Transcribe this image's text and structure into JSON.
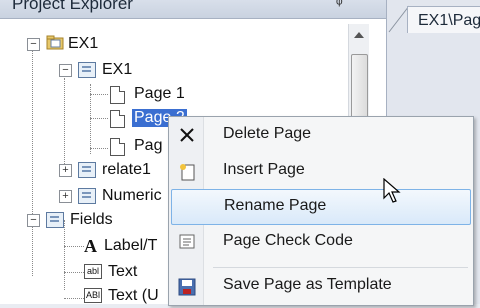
{
  "explorer": {
    "title": "Project Explorer",
    "pin_glyph": "ᵠ"
  },
  "tab": {
    "label": "EX1\\Pag"
  },
  "tree": {
    "root": "EX1",
    "view": "EX1",
    "page1": "Page 1",
    "page2": "Page 2",
    "page3": "Pag",
    "relate": "relate1",
    "numeric": "Numeric",
    "fields": "Fields",
    "label_field": "Label/T",
    "text_field": "Text",
    "text_upper": "Text (U"
  },
  "menu": {
    "items": [
      {
        "label": "Delete Page",
        "icon": "delete-x-icon"
      },
      {
        "label": "Insert Page",
        "icon": "insert-page-icon"
      },
      {
        "label": "Rename Page",
        "icon": "none"
      },
      {
        "label": "Page Check Code",
        "icon": "check-code-icon"
      },
      {
        "label": "Save Page as Template",
        "icon": "save-disk-icon"
      }
    ],
    "highlighted": "Rename Page"
  },
  "colors": {
    "selection": "#3b6fd1",
    "menu_highlight": "#d9e9f9"
  }
}
